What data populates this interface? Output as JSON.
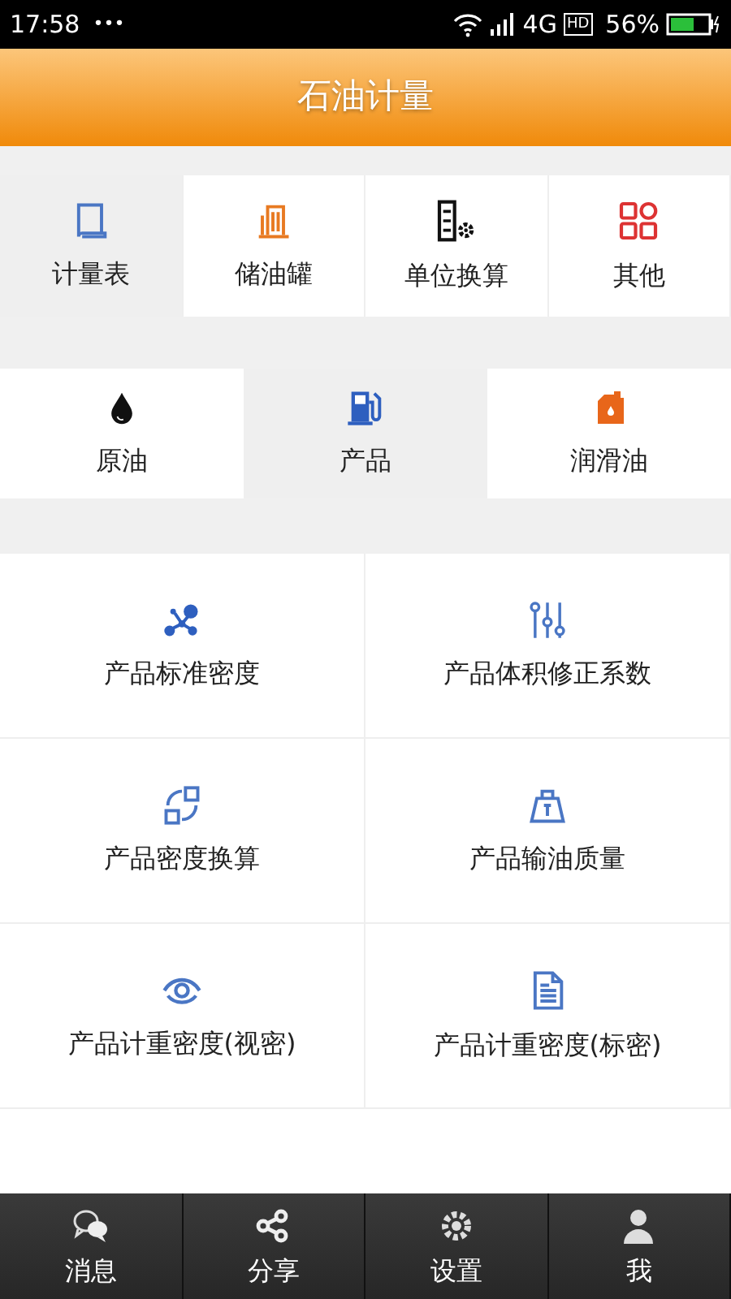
{
  "status_bar": {
    "time": "17:58",
    "dots": "•••",
    "network": "4G",
    "hd": "HD",
    "battery": "56%"
  },
  "header": {
    "title": "石油计量"
  },
  "categories": [
    {
      "label": "计量表",
      "kind": "book",
      "selected": true
    },
    {
      "label": "储油罐",
      "kind": "tank",
      "selected": false
    },
    {
      "label": "单位换算",
      "kind": "unit",
      "selected": false
    },
    {
      "label": "其他",
      "kind": "apps",
      "selected": false
    }
  ],
  "oil_types": [
    {
      "label": "原油",
      "kind": "drop",
      "selected": false
    },
    {
      "label": "产品",
      "kind": "pump",
      "selected": true
    },
    {
      "label": "润滑油",
      "kind": "can",
      "selected": false
    }
  ],
  "functions": [
    {
      "label": "产品标准密度",
      "kind": "molecule"
    },
    {
      "label": "产品体积修正系数",
      "kind": "sliders"
    },
    {
      "label": "产品密度换算",
      "kind": "convert"
    },
    {
      "label": "产品输油质量",
      "kind": "weight"
    },
    {
      "label": "产品计重密度(视密)",
      "kind": "eye"
    },
    {
      "label": "产品计重密度(标密)",
      "kind": "doc"
    }
  ],
  "bottom_nav": [
    {
      "label": "消息",
      "kind": "chat"
    },
    {
      "label": "分享",
      "kind": "share"
    },
    {
      "label": "设置",
      "kind": "gear"
    },
    {
      "label": "我",
      "kind": "person"
    }
  ]
}
